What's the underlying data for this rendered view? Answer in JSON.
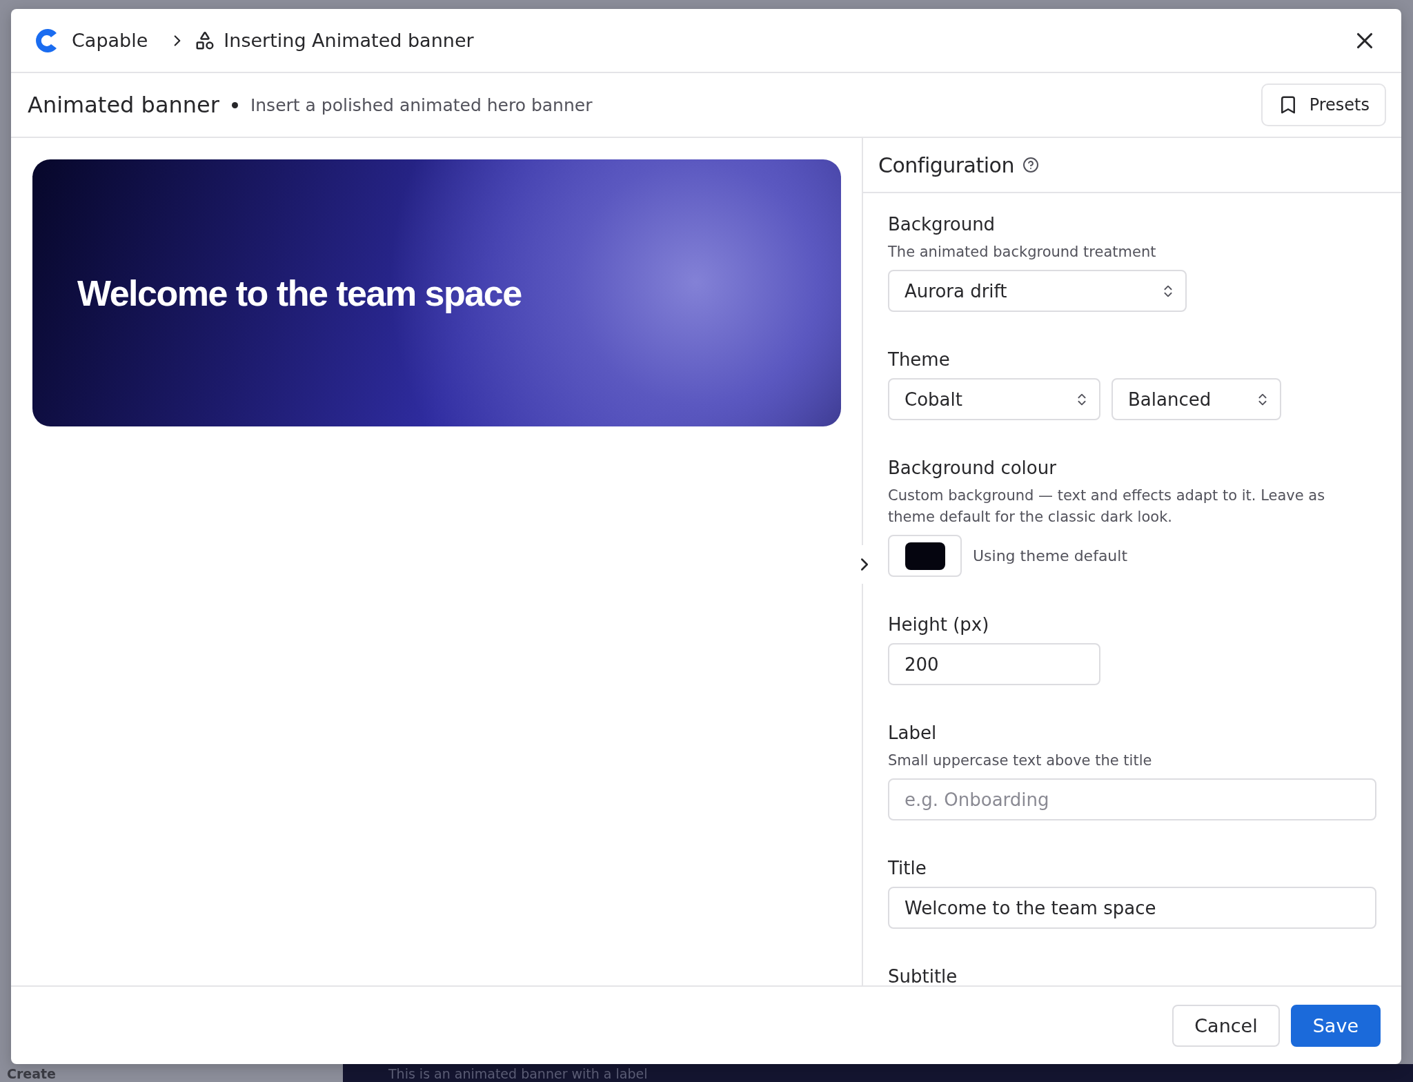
{
  "breadcrumb": {
    "app": "Capable",
    "page": "Inserting Animated banner"
  },
  "header": {
    "title": "Animated banner",
    "subtitle": "Insert a polished animated hero banner",
    "presets_button": "Presets"
  },
  "preview": {
    "banner_title": "Welcome to the team space"
  },
  "panel": {
    "title": "Configuration"
  },
  "fields": [
    {
      "kind": "select",
      "label": "Background",
      "description": "The animated background treatment",
      "values": [
        "Aurora drift"
      ]
    },
    {
      "kind": "select",
      "label": "Theme",
      "values": [
        "Cobalt",
        "Balanced"
      ]
    },
    {
      "kind": "color",
      "label": "Background colour",
      "description": "Custom background — text and effects adapt to it. Leave as theme default for the classic dark look.",
      "status": "Using theme default"
    },
    {
      "kind": "number",
      "label": "Height (px)",
      "value": "200"
    },
    {
      "kind": "text",
      "label": "Label",
      "description": "Small uppercase text above the title",
      "placeholder": "e.g. Onboarding"
    },
    {
      "kind": "text",
      "label": "Title",
      "value": "Welcome to the team space"
    },
    {
      "kind": "heading",
      "label": "Subtitle"
    }
  ],
  "footer": {
    "buttons": [
      {
        "label": "Cancel",
        "kind": "secondary"
      },
      {
        "label": "Save",
        "kind": "primary"
      }
    ]
  },
  "backdrop": {
    "sidebar_item": "Create",
    "banner_text": "This is an animated banner with a label"
  }
}
